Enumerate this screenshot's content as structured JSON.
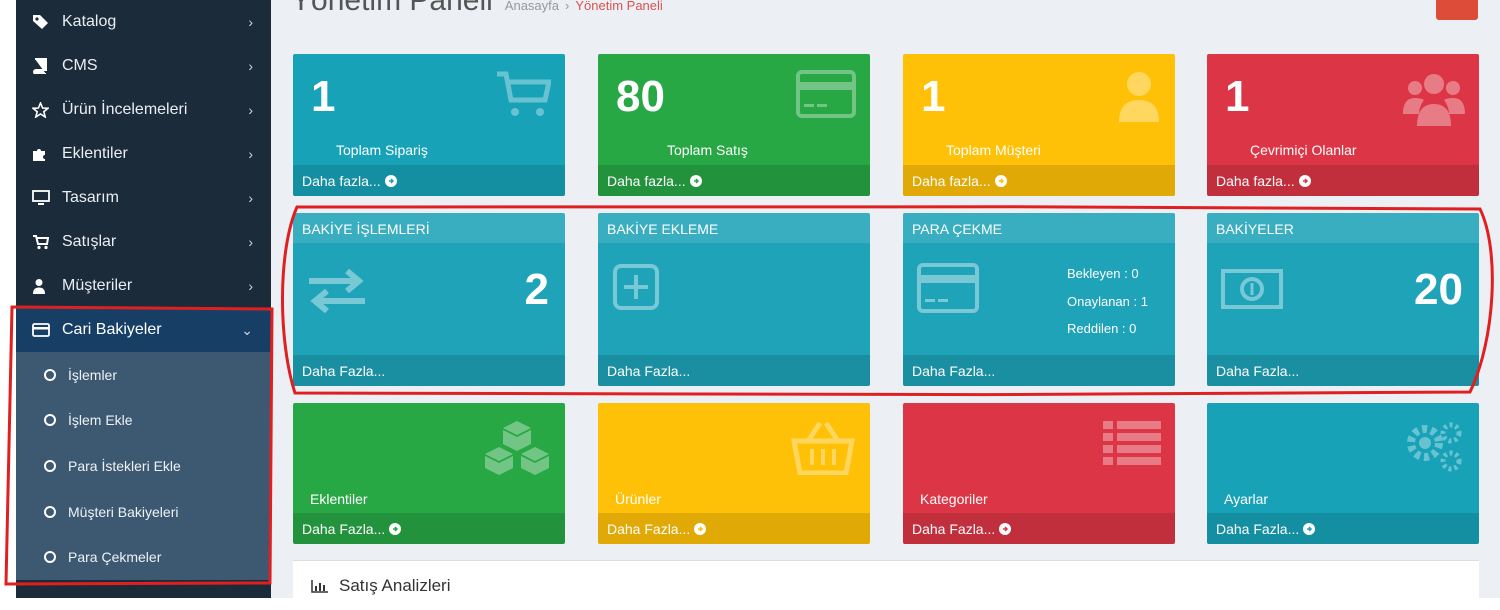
{
  "sidebar": {
    "items": [
      {
        "label": "Katalog",
        "icon": "tags-icon"
      },
      {
        "label": "CMS",
        "icon": "book-icon"
      },
      {
        "label": "Ürün İncelemeleri",
        "icon": "star-icon"
      },
      {
        "label": "Eklentiler",
        "icon": "puzzle-icon"
      },
      {
        "label": "Tasarım",
        "icon": "desktop-icon"
      },
      {
        "label": "Satışlar",
        "icon": "cart-icon"
      },
      {
        "label": "Müşteriler",
        "icon": "user-icon"
      },
      {
        "label": "Cari Bakiyeler",
        "icon": "credit-card-icon"
      }
    ],
    "subitems": [
      "İşlemler",
      "İşlem Ekle",
      "Para İstekleri Ekle",
      "Müşteri Bakiyeleri",
      "Para Çekmeler"
    ]
  },
  "header": {
    "title": "Yönetim Paneli",
    "crumb_home": "Anasayfa",
    "crumb_sep": "›",
    "crumb_current": "Yönetim Paneli"
  },
  "stats": [
    {
      "value": "1",
      "label": "Toplam Sipariş",
      "more": "Daha fazla...",
      "color": "#17a2b8",
      "icon": "cart-icon"
    },
    {
      "value": "80",
      "label": "Toplam Satış",
      "more": "Daha fazla...",
      "color": "#28a745",
      "icon": "credit-card-icon"
    },
    {
      "value": "1",
      "label": "Toplam Müşteri",
      "more": "Daha fazla...",
      "color": "#ffc107",
      "icon": "user-icon"
    },
    {
      "value": "1",
      "label": "Çevrimiçi Olanlar",
      "more": "Daha fazla...",
      "color": "#dc3545",
      "icon": "users-icon"
    }
  ],
  "balance": [
    {
      "title": "BAKİYE İŞLEMLERİ",
      "value": "2",
      "more": "Daha Fazla...",
      "icon": "exchange-icon"
    },
    {
      "title": "BAKİYE EKLEME",
      "more": "Daha Fazla...",
      "icon": "plus-square-icon"
    },
    {
      "title": "PARA ÇEKME",
      "pending": "Bekleyen : 0",
      "approved": "Onaylanan : 1",
      "rejected": "Reddilen : 0",
      "more": "Daha Fazla...",
      "icon": "credit-card-icon"
    },
    {
      "title": "BAKİYELER",
      "value": "20",
      "more": "Daha Fazla...",
      "icon": "money-icon"
    }
  ],
  "modules": [
    {
      "label": "Eklentiler",
      "more": "Daha Fazla...",
      "color": "#28a745",
      "icon": "cubes-icon"
    },
    {
      "label": "Ürünler",
      "more": "Daha Fazla...",
      "color": "#ffc107",
      "icon": "basket-icon"
    },
    {
      "label": "Kategoriler",
      "more": "Daha Fazla...",
      "color": "#dc3545",
      "icon": "list-icon"
    },
    {
      "label": "Ayarlar",
      "more": "Daha Fazla...",
      "color": "#17a2b8",
      "icon": "gears-icon"
    }
  ],
  "panel": {
    "title": "Satış Analizleri"
  }
}
